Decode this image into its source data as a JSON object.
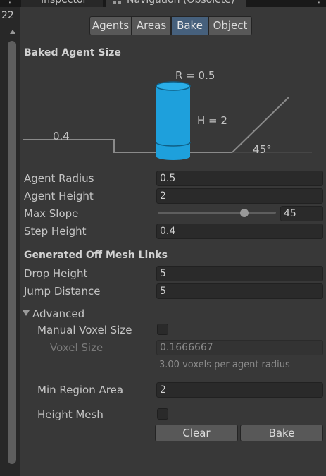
{
  "tabs": {
    "inspector_label": "Inspector",
    "navigation_label": "Navigation (Obsolete)",
    "menu_glyph": "⋮"
  },
  "gutter": {
    "line_number": "22"
  },
  "segments": [
    "Agents",
    "Areas",
    "Bake",
    "Object"
  ],
  "active_segment": "Bake",
  "baked_agent_size": {
    "heading": "Baked Agent Size",
    "radius_label": "R = 0.5",
    "height_label": "H = 2",
    "step_label": "0.4",
    "slope_label": "45°"
  },
  "fields": {
    "agent_radius": {
      "label": "Agent Radius",
      "value": "0.5"
    },
    "agent_height": {
      "label": "Agent Height",
      "value": "2"
    },
    "max_slope": {
      "label": "Max Slope",
      "value": "45",
      "slider_fraction": 0.73
    },
    "step_height": {
      "label": "Step Height",
      "value": "0.4"
    }
  },
  "off_mesh": {
    "heading": "Generated Off Mesh Links",
    "drop_height": {
      "label": "Drop Height",
      "value": "5"
    },
    "jump_distance": {
      "label": "Jump Distance",
      "value": "5"
    }
  },
  "advanced": {
    "label": "Advanced",
    "manual_voxel_size": {
      "label": "Manual Voxel Size",
      "checked": false
    },
    "voxel_size": {
      "label": "Voxel Size",
      "value": "0.1666667"
    },
    "voxel_hint": "3.00 voxels per agent radius",
    "min_region_area": {
      "label": "Min Region Area",
      "value": "2"
    },
    "height_mesh": {
      "label": "Height Mesh",
      "checked": false
    }
  },
  "buttons": {
    "clear": "Clear",
    "bake": "Bake"
  },
  "colors": {
    "agent_cylinder": "#1ea0dc",
    "active_segment": "#46607c",
    "background": "#383838"
  }
}
